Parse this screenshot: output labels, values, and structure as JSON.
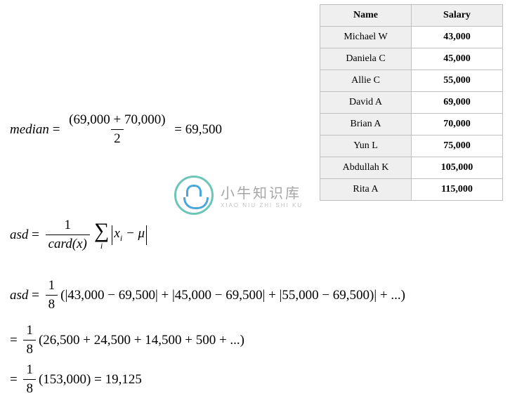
{
  "table": {
    "headers": {
      "name": "Name",
      "salary": "Salary"
    },
    "rows": [
      {
        "name": "Michael W",
        "salary": "43,000"
      },
      {
        "name": "Daniela C",
        "salary": "45,000"
      },
      {
        "name": "Allie C",
        "salary": "55,000"
      },
      {
        "name": "David A",
        "salary": "69,000"
      },
      {
        "name": "Brian A",
        "salary": "70,000"
      },
      {
        "name": "Yun L",
        "salary": "75,000"
      },
      {
        "name": "Abdullah K",
        "salary": "105,000"
      },
      {
        "name": "Rita A",
        "salary": "115,000"
      }
    ]
  },
  "formulas": {
    "median": {
      "lhs": "median",
      "num": "(69,000 + 70,000)",
      "den": "2",
      "result": "69,500"
    },
    "asd_def": {
      "lhs": "asd",
      "frac_num": "1",
      "frac_den": "card(x)",
      "sigma_sub": "i",
      "abs_inner_left": "x",
      "abs_inner_sub": "i",
      "abs_inner_op": " − μ"
    },
    "asd_expand": {
      "lhs": "asd",
      "frac_num": "1",
      "frac_den": "8",
      "body": "(|43,000 − 69,500| + |45,000 − 69,500| + |55,000 − 69,500)| + ...)"
    },
    "asd_step2": {
      "frac_num": "1",
      "frac_den": "8",
      "body": "(26,500 + 24,500 + 14,500 + 500 + ...)"
    },
    "asd_result": {
      "frac_num": "1",
      "frac_den": "8",
      "body": "(153,000) = 19,125"
    }
  },
  "watermark": {
    "cn": "小牛知识库",
    "py": "XIAO NIU ZHI SHI KU"
  },
  "chart_data": {
    "type": "table",
    "title": "Salaries",
    "columns": [
      "Name",
      "Salary"
    ],
    "rows": [
      [
        "Michael W",
        43000
      ],
      [
        "Daniela C",
        45000
      ],
      [
        "Allie C",
        55000
      ],
      [
        "David A",
        69000
      ],
      [
        "Brian A",
        70000
      ],
      [
        "Yun L",
        75000
      ],
      [
        "Abdullah K",
        105000
      ],
      [
        "Rita A",
        115000
      ]
    ],
    "derived": {
      "median": 69500,
      "average_absolute_deviation": 19125,
      "n": 8,
      "abs_dev_sum": 153000
    }
  }
}
